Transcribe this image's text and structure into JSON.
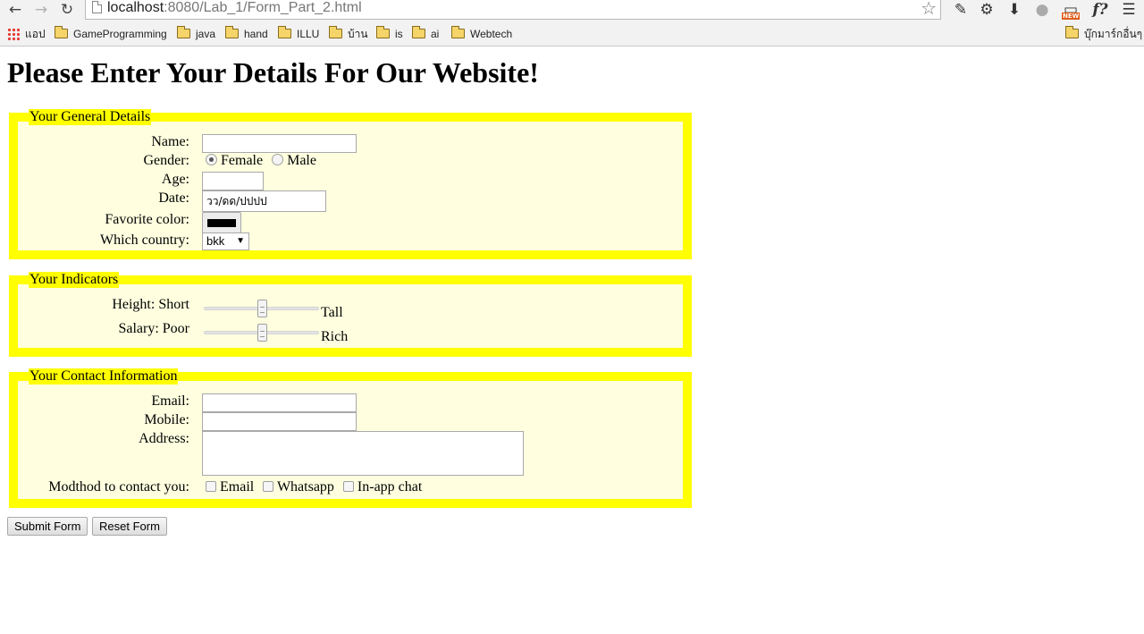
{
  "browser": {
    "url_host": "localhost",
    "url_rest": ":8080/Lab_1/Form_Part_2.html",
    "new_badge": "NEW",
    "fx_label": "f?",
    "bookmarks": [
      {
        "label": "แอป",
        "icon": "apps-grid-icon"
      },
      {
        "label": "GameProgramming",
        "icon": "folder-icon"
      },
      {
        "label": "java",
        "icon": "folder-icon"
      },
      {
        "label": "hand",
        "icon": "folder-icon"
      },
      {
        "label": "ILLU",
        "icon": "folder-icon"
      },
      {
        "label": "บ้าน",
        "icon": "folder-icon"
      },
      {
        "label": "is",
        "icon": "folder-icon"
      },
      {
        "label": "ai",
        "icon": "folder-icon"
      },
      {
        "label": "Webtech",
        "icon": "folder-icon"
      }
    ],
    "other_bookmarks": "บุ๊กมาร์กอื่นๆ"
  },
  "page": {
    "title": "Please Enter Your Details For Our Website!",
    "general": {
      "legend": "Your General Details",
      "name_label": "Name:",
      "name_value": "",
      "gender_label": "Gender:",
      "gender_options": [
        "Female",
        "Male"
      ],
      "gender_selected": "Female",
      "age_label": "Age:",
      "date_label": "Date:",
      "date_placeholder": "วว/ดด/ปปปป",
      "color_label": "Favorite color:",
      "color_value": "#000000",
      "country_label": "Which country:",
      "country_value": "bkk"
    },
    "indicators": {
      "legend": "Your Indicators",
      "height_label": "Height: Short",
      "height_end": "Tall",
      "height_value": 0.5,
      "salary_label": "Salary: Poor",
      "salary_end": "Rich",
      "salary_value": 0.5
    },
    "contact": {
      "legend": "Your Contact Information",
      "email_label": "Email:",
      "mobile_label": "Mobile:",
      "address_label": "Address:",
      "method_label": "Modthod to contact you:",
      "methods": [
        "Email",
        "Whatsapp",
        "In-app chat"
      ]
    },
    "buttons": {
      "submit": "Submit Form",
      "reset": "Reset Form"
    }
  },
  "colors": {
    "fieldset_border": "#ffff00",
    "fieldset_bg": "#ffffe0"
  }
}
